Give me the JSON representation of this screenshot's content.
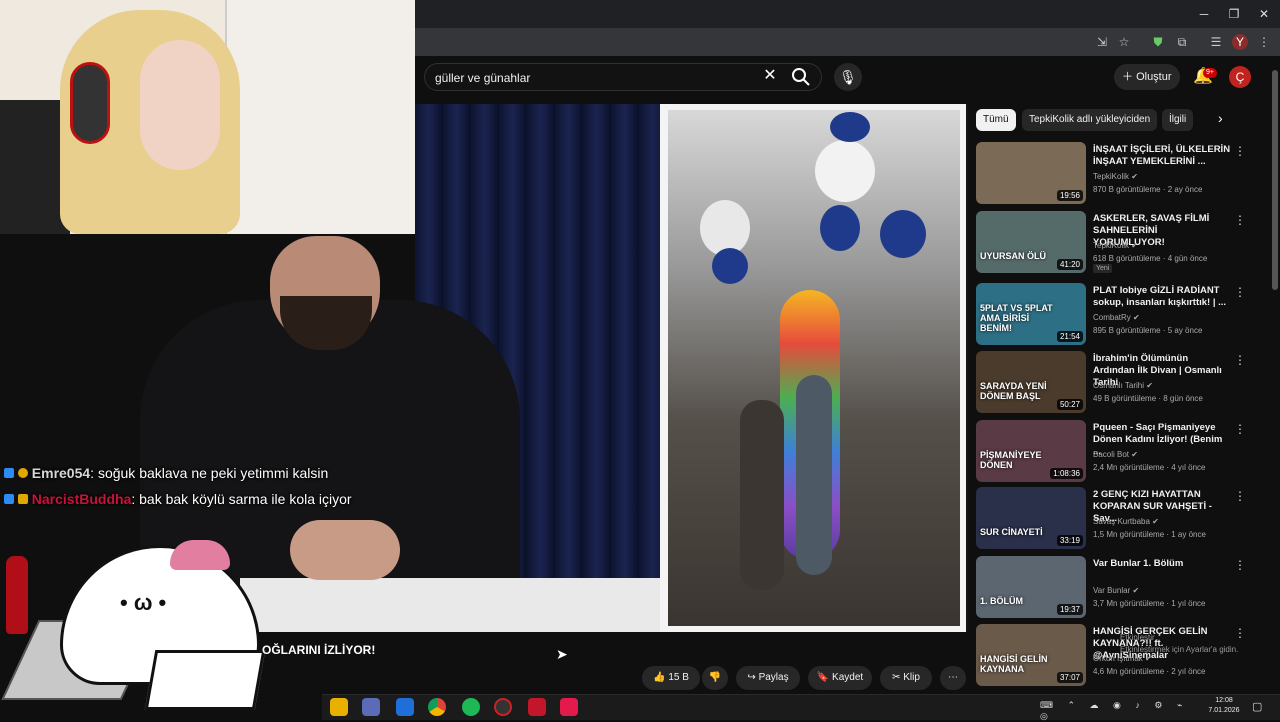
{
  "window_controls": {
    "minimize": "─",
    "restore": "❐",
    "close": "✕"
  },
  "profile_initial_browser": "Y",
  "search": {
    "value": "güller ve günahlar",
    "clear": "✕"
  },
  "header": {
    "create_label": "Oluştur",
    "notifications_badge": "9+",
    "avatar_initial": "Ç"
  },
  "chat": [
    {
      "user": "Emre054",
      "message": ": soğuk baklava ne peki yetimmi kalsin"
    },
    {
      "user": "NarcistBuddha",
      "message": ": bak bak köylü sarma ile kola içiyor"
    }
  ],
  "overlay_banner": "OĞLARINI İZLİYOR!",
  "actions": {
    "like_count": "15 B",
    "share": "Paylaş",
    "save": "Kaydet",
    "clip": "Klip",
    "more": "⋯"
  },
  "chips": [
    "Tümü",
    "TepkiKolik adlı yükleyiciden",
    "İlgili"
  ],
  "recommendations": [
    {
      "title": "İNŞAAT İŞÇİLERİ, ÜLKELERİN İNŞAAT YEMEKLERİNİ ...",
      "channel": "TepkiKolik",
      "meta": "870 B görüntüleme · 2 ay önce",
      "duration": "19:56",
      "thumb_color": "#7b6a55"
    },
    {
      "title": "ASKERLER, SAVAŞ FİLMİ SAHNELERİNİ YORUMLUYOR!",
      "channel": "TepkiKolik",
      "meta": "618 B görüntüleme · 4 gün önce",
      "duration": "41:20",
      "badge": "Yeni",
      "thumb_color": "#556b6a",
      "thumb_text": "UYURSAN ÖLÜ"
    },
    {
      "title": "PLAT Iobiye GİZLİ RADİANT sokup, insanları kışkırttık! | ...",
      "channel": "CombatRy",
      "meta": "895 B görüntüleme · 5 ay önce",
      "duration": "21:54",
      "thumb_color": "#2d6f85",
      "thumb_text": "5PLAT VS 5PLAT AMA BİRİSİ BENİM!"
    },
    {
      "title": "İbrahim'in Ölümünün Ardından İlk Divan | Osmanlı Tarihi",
      "channel": "Osmanlı Tarihi",
      "meta": "49 B görüntüleme · 8 gün önce",
      "duration": "50:27",
      "thumb_color": "#4a3b2c",
      "thumb_text": "SARAYDA YENİ DÖNEM BAŞL"
    },
    {
      "title": "Pqueen - Saçı Pişmaniyeye Dönen Kadını İzliyor! (Benim ...",
      "channel": "Bacoli Bot",
      "meta": "2,4 Mn görüntüleme · 4 yıl önce",
      "duration": "1:08:36",
      "thumb_color": "#5a3a44",
      "thumb_text": "PİŞMANİYEYE DÖNEN"
    },
    {
      "title": "2 GENÇ KIZI HAYATTAN KOPARAN SUR VAHŞETİ - Sav...",
      "channel": "Savaş Kurtbaba",
      "meta": "1,5 Mn görüntüleme · 1 ay önce",
      "duration": "33:19",
      "thumb_color": "#2a2f4a",
      "thumb_text": "SUR CİNAYETİ"
    },
    {
      "title": "Var Bunlar 1. Bölüm",
      "channel": "Var Bunlar",
      "meta": "3,7 Mn görüntüleme · 1 yıl önce",
      "duration": "19:37",
      "thumb_color": "#5c6670",
      "thumb_text": "1. BÖLÜM"
    },
    {
      "title": "HANGİSİ GERÇEK GELİN KAYNANA?!! ft. @AyniSinemalar",
      "channel": "Orkun Işıtmak",
      "meta": "4,6 Mn görüntüleme · 2 yıl önce",
      "duration": "37:07",
      "thumb_color": "#6a5a4a",
      "thumb_text": "HANGİSİ GELİN KAYNANA"
    }
  ],
  "watermark": "Etkinleştir\nEtkinleştirmek için Ayarlar'a gidin.",
  "taskbar": {
    "time": "12:08",
    "date": "7.01.2026"
  }
}
